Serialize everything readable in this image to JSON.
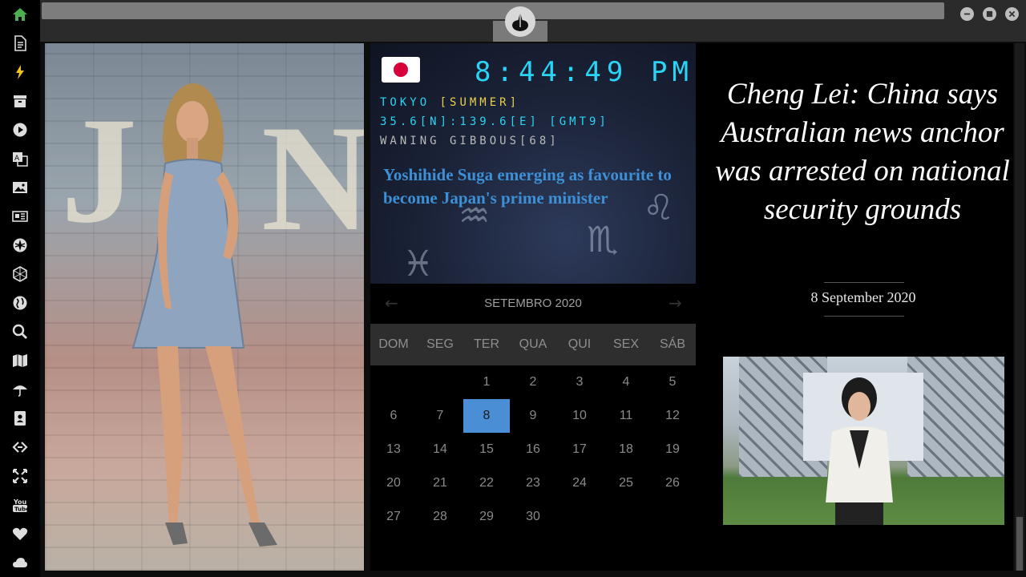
{
  "sidebar": {
    "items": [
      {
        "icon": "home-icon",
        "color": "#4caf50"
      },
      {
        "icon": "document-icon"
      },
      {
        "icon": "lightning-icon",
        "color": "#f0c419"
      },
      {
        "icon": "archive-icon"
      },
      {
        "icon": "play-icon"
      },
      {
        "icon": "translate-icon"
      },
      {
        "icon": "image-icon"
      },
      {
        "icon": "newspaper-icon"
      },
      {
        "icon": "rebel-alliance-icon"
      },
      {
        "icon": "hexagon-icon"
      },
      {
        "icon": "globe-icon"
      },
      {
        "icon": "search-icon"
      },
      {
        "icon": "map-icon"
      },
      {
        "icon": "umbrella-icon"
      },
      {
        "icon": "contact-card-icon"
      },
      {
        "icon": "link-icon"
      },
      {
        "icon": "expand-icon"
      },
      {
        "icon": "youtube-icon"
      },
      {
        "icon": "heart-icon"
      },
      {
        "icon": "cloud-icon"
      }
    ]
  },
  "clock": {
    "time": "8:44:49",
    "ampm": "PM",
    "city": "TOKYO",
    "season": "[SUMMER]",
    "coords": "35.6[N]:139.6[E] [GMT9]",
    "moon": "WANING GIBBOUS[68]",
    "headline": "Yoshihide Suga emerging as favourite to become Japan's prime minister",
    "flag_color": "#d7003a",
    "lcd_color": "#2ad4f5"
  },
  "calendar": {
    "title": "SETEMBRO 2020",
    "weekdays": [
      "DOM",
      "SEG",
      "TER",
      "QUA",
      "QUI",
      "SEX",
      "SÁB"
    ],
    "days": [
      "1",
      "2",
      "3",
      "4",
      "5",
      "6",
      "7",
      "8",
      "9",
      "10",
      "11",
      "12",
      "13",
      "14",
      "15",
      "16",
      "17",
      "18",
      "19",
      "20",
      "21",
      "22",
      "23",
      "24",
      "25",
      "26",
      "27",
      "28",
      "29",
      "30"
    ],
    "first_weekday_index": 2,
    "today": "8",
    "accent": "#4a8fd6"
  },
  "news": {
    "headline": "Cheng Lei: China says Australian news anchor was arrested on national security grounds",
    "date": "8 September 2020"
  }
}
